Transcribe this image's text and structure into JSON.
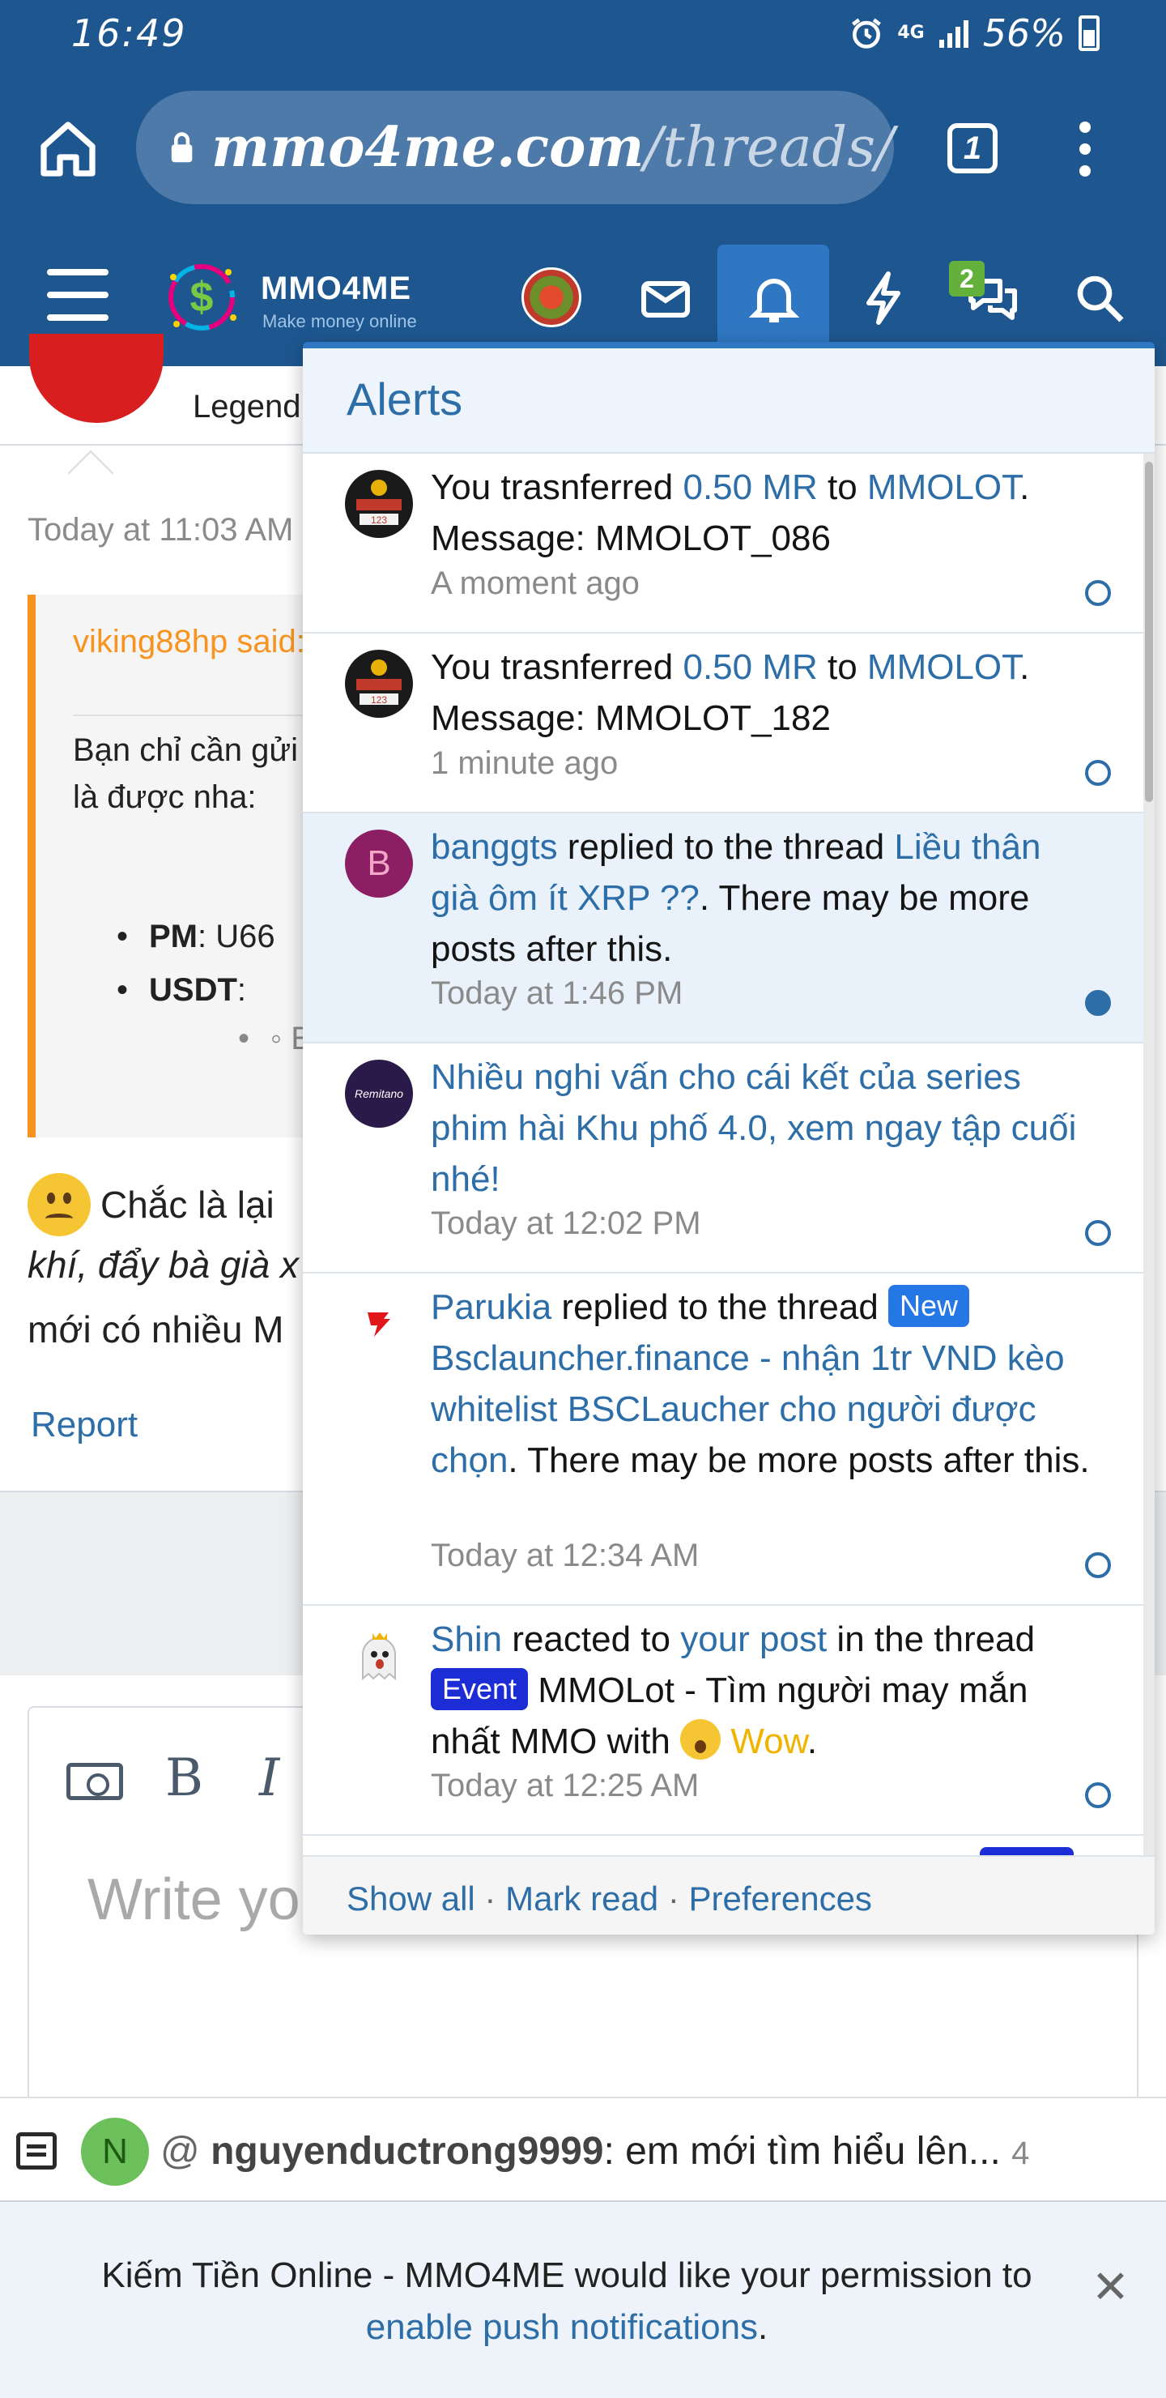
{
  "statusbar": {
    "time": "16:49",
    "right": "56%",
    "network": "4G"
  },
  "browser": {
    "url_host": "mmo4me.com",
    "url_path": "/threads/",
    "tab_count": "1"
  },
  "site": {
    "name": "MMO4ME",
    "tagline": "Make money online",
    "conversations_badge": "2"
  },
  "background_post": {
    "author_title": "Legend",
    "date": "Today at 11:03 AM",
    "quote_author": "viking88hp said:",
    "quote_line1": "Bạn chỉ cần gửi",
    "quote_line2": "là được nha:",
    "list_pm_label": "PM",
    "list_pm_value": ": U66",
    "list_usdt_label": "USDT",
    "list_usdt_value": ":",
    "sub_item": "◦ E",
    "text_line1": "Chắc là lại",
    "text_line2": "khí, đẩy bà già x",
    "text_line3": "mới có nhiều M",
    "report": "Report"
  },
  "editor": {
    "bold": "B",
    "italic": "I",
    "placeholder": "Write yo"
  },
  "alerts": {
    "title": "Alerts",
    "items": [
      {
        "pre": "You trasnferred ",
        "link1": "0.50 MR",
        "mid": " to ",
        "link2": "MMOLOT",
        "post": ". Message: MMOLOT_086",
        "time": "A moment ago",
        "unread": false
      },
      {
        "pre": "You trasnferred ",
        "link1": "0.50 MR",
        "mid": " to ",
        "link2": "MMOLOT",
        "post": ". Message: MMOLOT_182",
        "time": "1 minute ago",
        "unread": false
      },
      {
        "avatar_letter": "B",
        "link1": "banggts",
        "mid": " replied to the thread ",
        "link2": "Liều thân già ôm ít XRP ??",
        "post": ". There may be more posts after this.",
        "time": "Today at 1:46 PM",
        "unread": true
      },
      {
        "avatar_label": "Remitano",
        "link1": "Nhiều nghi vấn cho cái kết của series phim hài Khu phố 4.0, xem ngay tập cuối nhé!",
        "time": "Today at 12:02 PM",
        "unread": false
      },
      {
        "link1": "Parukia",
        "mid": " replied to the thread ",
        "tag": "New",
        "link2": "Bsclauncher.finance - nhận 1tr VND kèo whitelist BSCLaucher cho người được chọn",
        "post": ". There may be more posts after this.",
        "time": "Today at 12:34 AM",
        "unread": false
      },
      {
        "link1": "Shin",
        "mid": " reacted to ",
        "link2": "your post",
        "mid2": " in the thread ",
        "tag": "Event",
        "post": " MMOLot - Tìm người may mắn nhất MMO with ",
        "reaction": "Wow",
        "time": "Today at 12:25 AM",
        "unread": false
      }
    ],
    "footer": {
      "show_all": "Show all",
      "mark_read": "Mark read",
      "preferences": "Preferences"
    }
  },
  "chat": {
    "avatar_letter": "N",
    "at": "@ ",
    "user": "nguyenductrong9999",
    "message": ": em mới tìm hiểu lên...",
    "count": "4"
  },
  "push": {
    "line1": "Kiếm Tiền Online - MMO4ME would like your permission to",
    "link": "enable push notifications",
    "period": ".",
    "close": "✕"
  },
  "colors": {
    "header": "#1e5790",
    "accent": "#2d6ea8",
    "unread_bg": "#e9f2fb",
    "quote_border": "#f7931e"
  }
}
